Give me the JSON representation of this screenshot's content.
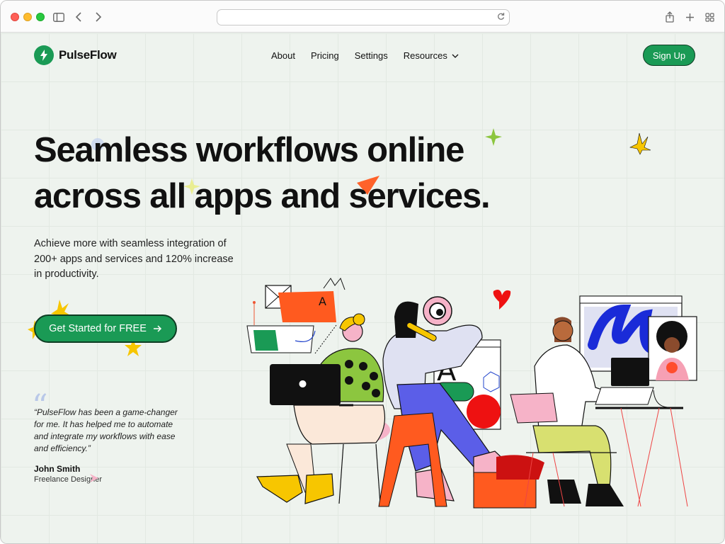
{
  "browser": {
    "url": ""
  },
  "brand": {
    "name": "PulseFlow",
    "color": "#1a9a55"
  },
  "nav": {
    "items": [
      {
        "label": "About"
      },
      {
        "label": "Pricing"
      },
      {
        "label": "Settings"
      },
      {
        "label": "Resources"
      }
    ],
    "signup_label": "Sign Up"
  },
  "hero": {
    "headline_line1": "Seamless workflows online",
    "headline_line2": "across all apps and services.",
    "subtext": "Achieve more with seamless integration of 200+ apps and services and 120% increase in productivity.",
    "cta_label": "Get Started for FREE"
  },
  "testimonial": {
    "quote": "“PulseFlow has been a game-changer for me. It has helped me to automate and integrate my workflows with ease and efficiency.”",
    "author": "John Smith",
    "role": "Freelance Designer"
  },
  "icons": [
    "sidebar-icon",
    "back-icon",
    "forward-icon",
    "reload-icon",
    "share-icon",
    "new-tab-icon",
    "tab-overview-icon",
    "lightning-icon",
    "chevron-down-icon",
    "arrow-right-icon"
  ],
  "colors": {
    "accent": "#1a9a55",
    "background": "#eef3ee",
    "star_yellow": "#f7c600"
  }
}
